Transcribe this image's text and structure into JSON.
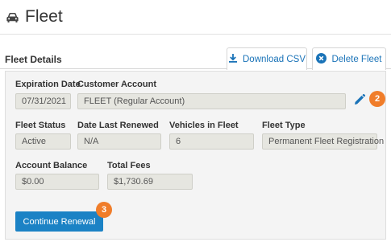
{
  "header": {
    "title": "Fleet",
    "icon": "car-icon"
  },
  "section": {
    "title": "Fleet Details"
  },
  "actions": {
    "download_label": "Download CSV",
    "download_icon": "download-icon",
    "delete_label": "Delete Fleet",
    "delete_icon": "close-circle-icon"
  },
  "fields": {
    "expiration_date": {
      "label": "Expiration Date",
      "value": "07/31/2021"
    },
    "customer_account": {
      "label": "Customer Account",
      "value": "FLEET (Regular Account)"
    },
    "fleet_status": {
      "label": "Fleet Status",
      "value": "Active"
    },
    "date_last_renewed": {
      "label": "Date Last Renewed",
      "value": "N/A"
    },
    "vehicles_in_fleet": {
      "label": "Vehicles in Fleet",
      "value": "6"
    },
    "fleet_type": {
      "label": "Fleet Type",
      "value": "Permanent Fleet Registration"
    },
    "account_balance": {
      "label": "Account Balance",
      "value": "$0.00"
    },
    "total_fees": {
      "label": "Total Fees",
      "value": "$1,730.69"
    }
  },
  "edit": {
    "icon": "pencil-icon"
  },
  "badges": {
    "step_2": "2",
    "step_3": "3"
  },
  "continue_label": "Continue Renewal",
  "colors": {
    "accent": "#1b82c5",
    "badge": "#f07d2a",
    "field_bg": "#e6e6e0",
    "panel_bg": "#f4f4f4"
  }
}
